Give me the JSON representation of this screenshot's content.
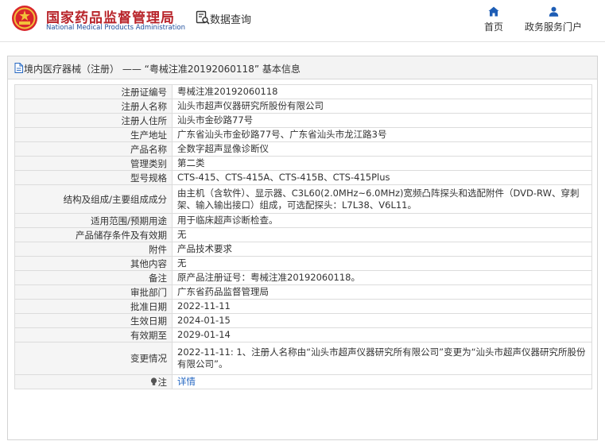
{
  "header": {
    "logo_cn": "国家药品监督管理局",
    "logo_en": "National Medical Products Administration",
    "search_label": "数据查询",
    "nav_home": "首页",
    "nav_portal": "政务服务门户"
  },
  "panel": {
    "title": "境内医疗器械（注册） ——  “粤械注准20192060118”  基本信息"
  },
  "rows": [
    {
      "key": "注册证编号",
      "value": "粤械注准20192060118"
    },
    {
      "key": "注册人名称",
      "value": "汕头市超声仪器研究所股份有限公司"
    },
    {
      "key": "注册人住所",
      "value": "汕头市金砂路77号"
    },
    {
      "key": "生产地址",
      "value": "广东省汕头市金砂路77号、广东省汕头市龙江路3号"
    },
    {
      "key": "产品名称",
      "value": "全数字超声显像诊断仪"
    },
    {
      "key": "管理类别",
      "value": "第二类"
    },
    {
      "key": "型号规格",
      "value": "CTS-415、CTS-415A、CTS-415B、CTS-415Plus"
    },
    {
      "key": "结构及组成/主要组成成分",
      "value": "由主机（含软件）、显示器、C3L60(2.0MHz~6.0MHz)宽频凸阵探头和选配附件（DVD-RW、穿刺架、输入输出接口）组成，可选配探头：L7L38、V6L11。"
    },
    {
      "key": "适用范围/预期用途",
      "value": "用于临床超声诊断检查。"
    },
    {
      "key": "产品储存条件及有效期",
      "value": "无"
    },
    {
      "key": "附件",
      "value": "产品技术要求"
    },
    {
      "key": "其他内容",
      "value": "无"
    },
    {
      "key": "备注",
      "value": "原产品注册证号：粤械注准20192060118。"
    },
    {
      "key": "审批部门",
      "value": "广东省药品监督管理局"
    },
    {
      "key": "批准日期",
      "value": "2022-11-11"
    },
    {
      "key": "生效日期",
      "value": "2024-01-15"
    },
    {
      "key": "有效期至",
      "value": "2029-01-14"
    },
    {
      "key": "变更情况",
      "value": "2022-11-11: 1、注册人名称由“汕头市超声仪器研究所有限公司”变更为“汕头市超声仪器研究所股份有限公司”。"
    },
    {
      "key": "注",
      "value": "详情"
    }
  ]
}
